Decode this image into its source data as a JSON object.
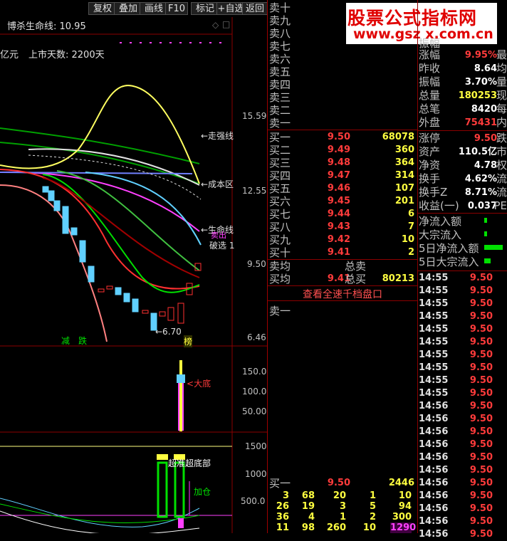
{
  "toolbar": {
    "buttons": [
      "复权",
      "叠加",
      "画线",
      "F10",
      "标记",
      "+自选",
      "返回"
    ]
  },
  "watermark": {
    "cn": "股票公式指标网",
    "url": "www.gsz x.com.cn"
  },
  "chart_header": {
    "indicator": "博杀生命线: 10.95",
    "cap_fragment": "亿元",
    "listing_days": "上市天数: 2200天"
  },
  "chart_labels": {
    "strong": "←走强线",
    "cost": "←成本区",
    "life": "←生命线",
    "sell": "卖出",
    "break": "破选",
    "break_num": "1",
    "low_price": "←6.70",
    "jian": "减",
    "die": "跌",
    "bang": "榜",
    "dadi": "大底",
    "chaodi": "超准超底部",
    "jiacang": "加仓"
  },
  "price_axis": [
    "15.59",
    "12.55",
    "9.50",
    "6.46"
  ],
  "ind_axis": [
    "150.0",
    "100.0",
    "50.00"
  ],
  "vol_axis": [
    "1500",
    "1000",
    "500.0"
  ],
  "chart_data": {
    "type": "line",
    "yaxis_price": [
      6.46,
      9.5,
      12.55,
      15.59
    ],
    "yaxis_indicator": [
      50.0,
      100.0,
      150.0
    ],
    "yaxis_volume": [
      500.0,
      1000,
      1500
    ],
    "annotations": [
      "←走强线",
      "←成本区",
      "←生命线",
      "←6.70",
      "大底"
    ]
  },
  "orderbook": {
    "sells": [
      {
        "label": "卖十",
        "price": "",
        "vol": ""
      },
      {
        "label": "卖九",
        "price": "",
        "vol": ""
      },
      {
        "label": "卖八",
        "price": "",
        "vol": ""
      },
      {
        "label": "卖七",
        "price": "",
        "vol": ""
      },
      {
        "label": "卖六",
        "price": "",
        "vol": ""
      },
      {
        "label": "卖五",
        "price": "",
        "vol": ""
      },
      {
        "label": "卖四",
        "price": "",
        "vol": ""
      },
      {
        "label": "卖三",
        "price": "",
        "vol": ""
      },
      {
        "label": "卖二",
        "price": "",
        "vol": ""
      },
      {
        "label": "卖一",
        "price": "",
        "vol": ""
      }
    ],
    "buys": [
      {
        "label": "买一",
        "price": "9.50",
        "vol": "68078"
      },
      {
        "label": "买二",
        "price": "9.49",
        "vol": "360"
      },
      {
        "label": "买三",
        "price": "9.48",
        "vol": "364"
      },
      {
        "label": "买四",
        "price": "9.47",
        "vol": "314"
      },
      {
        "label": "买五",
        "price": "9.46",
        "vol": "107"
      },
      {
        "label": "买六",
        "price": "9.45",
        "vol": "201"
      },
      {
        "label": "买七",
        "price": "9.44",
        "vol": "6"
      },
      {
        "label": "买八",
        "price": "9.43",
        "vol": "7"
      },
      {
        "label": "买九",
        "price": "9.42",
        "vol": "10"
      },
      {
        "label": "买十",
        "price": "9.41",
        "vol": "2"
      }
    ],
    "avg_sell_label": "卖均",
    "total_sell_label": "总卖",
    "avg_buy_label": "买均",
    "avg_buy_price": "9.41",
    "total_buy_label": "总买",
    "total_buy_vol": "80213",
    "view_all": "查看全速千档盘口",
    "sell1_label": "卖一",
    "buy1_label": "买一",
    "buy1_price": "9.50",
    "buy1_vol": "2446",
    "queue": [
      [
        "3",
        "68",
        "20",
        "1",
        "10"
      ],
      [
        "26",
        "19",
        "3",
        "5",
        "94"
      ],
      [
        "36",
        "4",
        "1",
        "2",
        "300"
      ],
      [
        "11",
        "98",
        "260",
        "10",
        "1290"
      ]
    ]
  },
  "stats": [
    {
      "label": "涨幅",
      "val": "9.95%",
      "cls": "red",
      "cut": "最"
    },
    {
      "label": "昨收",
      "val": "8.64",
      "cls": "white",
      "cut": "均"
    },
    {
      "label": "振幅",
      "val": "3.70%",
      "cls": "white",
      "cut": "量"
    },
    {
      "label": "总量",
      "val": "180253",
      "cls": "yellow",
      "cut": "现"
    },
    {
      "label": "总笔",
      "val": "8420",
      "cls": "white",
      "cut": "每"
    },
    {
      "label": "外盘",
      "val": "75431",
      "cls": "red",
      "cut": "内"
    },
    {
      "label": "涨停",
      "val": "9.50",
      "cls": "red",
      "cut": "跌"
    },
    {
      "label": "资产",
      "val": "110.5亿",
      "cls": "white",
      "cut": "市"
    },
    {
      "label": "净资",
      "val": "4.78",
      "cls": "white",
      "cut": "权"
    },
    {
      "label": "换手",
      "val": "4.62%",
      "cls": "white",
      "cut": "流"
    },
    {
      "label": "换手Z",
      "val": "8.71%",
      "cls": "white",
      "cut": "流"
    },
    {
      "label": "收益(一)",
      "val": "0.037",
      "cls": "white",
      "cut": "PE"
    }
  ],
  "stats_partial": "振幅",
  "flows": [
    {
      "label": "净流入额"
    },
    {
      "label": "大宗流入"
    },
    {
      "label": "5日净流入额"
    },
    {
      "label": "5日大宗流入"
    }
  ],
  "ticks": [
    {
      "t": "14:55",
      "p": "9.50"
    },
    {
      "t": "14:55",
      "p": "9.50"
    },
    {
      "t": "14:55",
      "p": "9.50"
    },
    {
      "t": "14:55",
      "p": "9.50"
    },
    {
      "t": "14:55",
      "p": "9.50"
    },
    {
      "t": "14:55",
      "p": "9.50"
    },
    {
      "t": "14:55",
      "p": "9.50"
    },
    {
      "t": "14:55",
      "p": "9.50"
    },
    {
      "t": "14:55",
      "p": "9.50"
    },
    {
      "t": "14:55",
      "p": "9.50"
    },
    {
      "t": "14:56",
      "p": "9.50"
    },
    {
      "t": "14:56",
      "p": "9.50"
    },
    {
      "t": "14:56",
      "p": "9.50"
    },
    {
      "t": "14:56",
      "p": "9.50"
    },
    {
      "t": "14:56",
      "p": "9.50"
    },
    {
      "t": "14:56",
      "p": "9.50"
    },
    {
      "t": "14:56",
      "p": "9.50"
    },
    {
      "t": "14:56",
      "p": "9.50"
    },
    {
      "t": "14:56",
      "p": "9.50"
    },
    {
      "t": "14:56",
      "p": "9.50"
    },
    {
      "t": "14:56",
      "p": "9.50"
    }
  ],
  "colors": {
    "red": "#ff3b3b",
    "green": "#00e000",
    "yellow": "#ffff40",
    "border": "#8b0000"
  }
}
